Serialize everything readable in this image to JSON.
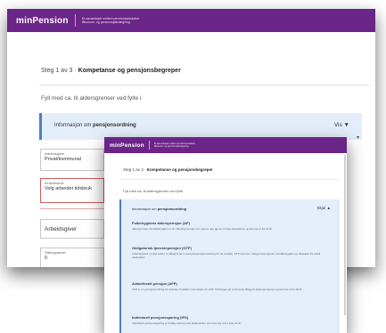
{
  "back_window": {
    "header": {
      "logo": "minPension",
      "tagline_1": "Et samarbejde mellem pensionsselskaber",
      "tagline_2": "Økonomi- og pensionsplanlægning"
    },
    "stage": {
      "prefix": "Steg 1 av 3",
      "title": "Kompetanse og pensjonsbegreper"
    },
    "question": "Fyll med ca. til aldersgrenser ved fylte i",
    "info": {
      "prefix": "Informasjon om",
      "bold": "pensjonsordning",
      "toggle": "Vis ▼"
    },
    "fields": [
      {
        "label": "Arbeidsgiver",
        "value": "Privat/kommunal"
      },
      {
        "label": "Inntektsnivå",
        "value": "Velg arbeidet tidsbruk"
      },
      {
        "label": "",
        "value": "Arbeidsgiver"
      },
      {
        "label": "Stillingsandel",
        "value": "0"
      }
    ],
    "dropdown_marker": "▾"
  },
  "front_window": {
    "header": {
      "logo": "minPension",
      "tagline_1": "Et samarbejde mellem pensionsselskaber",
      "tagline_2": "Økonomi- og pensionsplanlægning"
    },
    "stage": {
      "prefix": "Steg 1 av 3",
      "title": "Kompetanse og pensjonsbegreper"
    },
    "question": "Fyll med ca. til aldersgrenser ved fylte",
    "info": {
      "prefix": "Informasjon om",
      "bold": "pensjonsordning",
      "toggle": "Skjul ▲",
      "items": [
        {
          "title": "Folketrygdens alderspensjon (AP)",
          "desc": "Alderspensjon fra folketrygden er en offentlig pensjon som tjenes opp gjennom hele arbeidslivet og kan tas ut fra 62 år."
        },
        {
          "title": "Obligatorisk tjenestepensjon (OTP)",
          "desc": "Arbeidsgivere i privat sektor er pålagt å ha en tjenestepensjonsordning for de ansatte. OTP kommer i tillegg til pensjonen fra folketrygden og utbetales fra avtalt uttaksalder."
        },
        {
          "title": "Avtalefestet pensjon (AFP)",
          "desc": "AFP er en pensjonsordning for ansatte i bedrifter med avtale om AFP. Ordningen gir et livsvarig tillegg til alderspensjonen og kan tas ut fra 62 år."
        },
        {
          "title": "Individuell pensjonssparing (IPS)",
          "desc": "Individuell pensjonssparing er frivillig sparing med skattefordel, som kan tas ut fra fylte 62 år."
        }
      ]
    }
  }
}
